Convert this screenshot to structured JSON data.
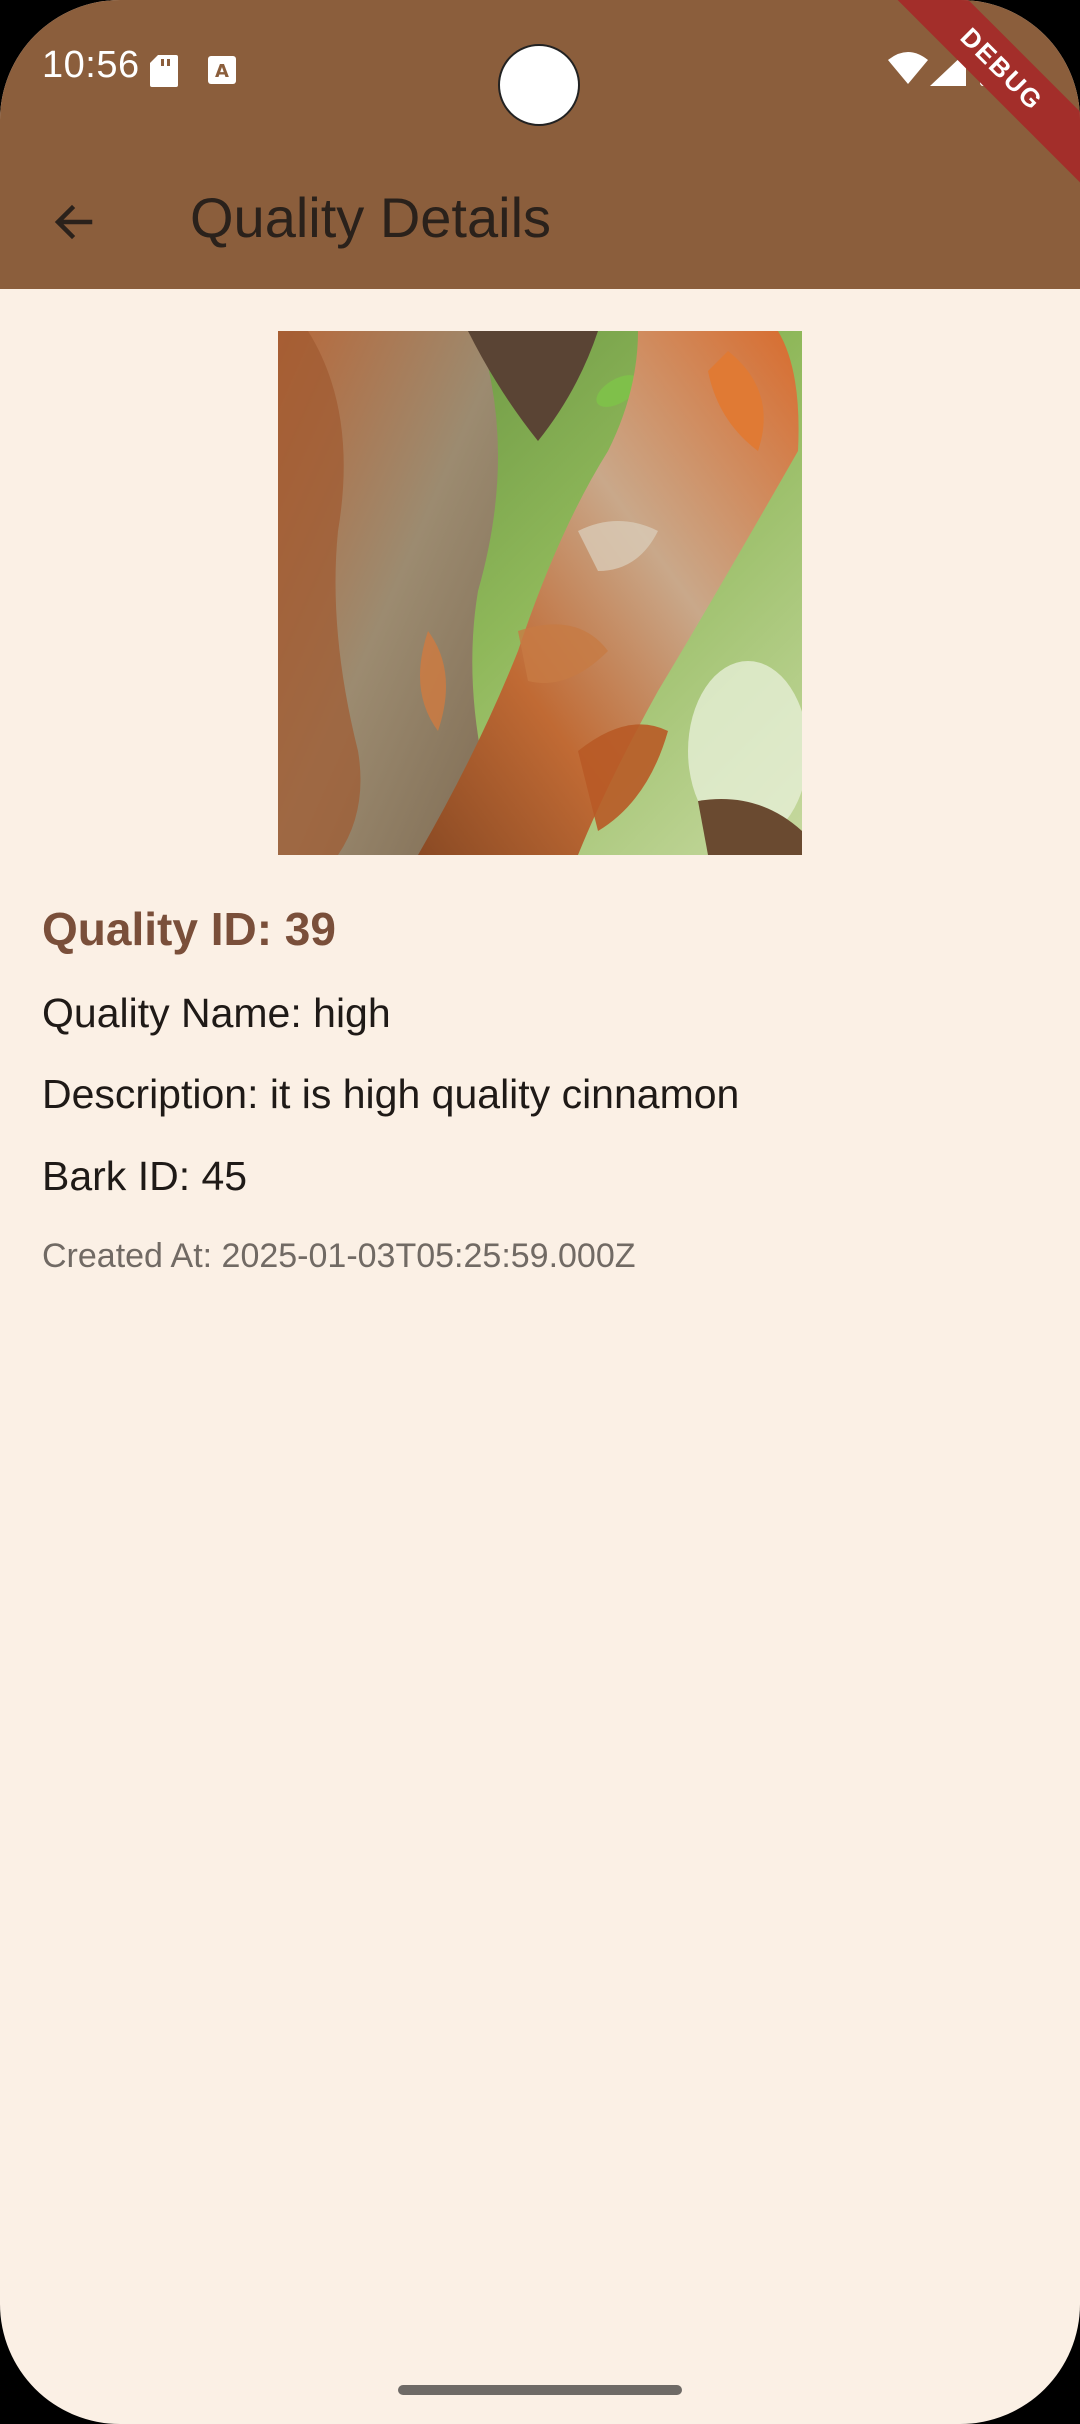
{
  "status_bar": {
    "time": "10:56",
    "debug_label": "DEBUG"
  },
  "app_bar": {
    "title": "Quality Details",
    "background_color": "#8b5e3c"
  },
  "details": {
    "quality_id": "Quality ID: 39",
    "quality_name": "Quality Name: high",
    "description": "Description: it is high quality cinnamon",
    "bark_id": "Bark ID: 45",
    "created_at": "Created At: 2025-01-03T05:25:59.000Z"
  },
  "colors": {
    "page_background": "#fbf0e5",
    "accent_brown": "#7a4f3a",
    "debug_red": "#a32e2a"
  }
}
